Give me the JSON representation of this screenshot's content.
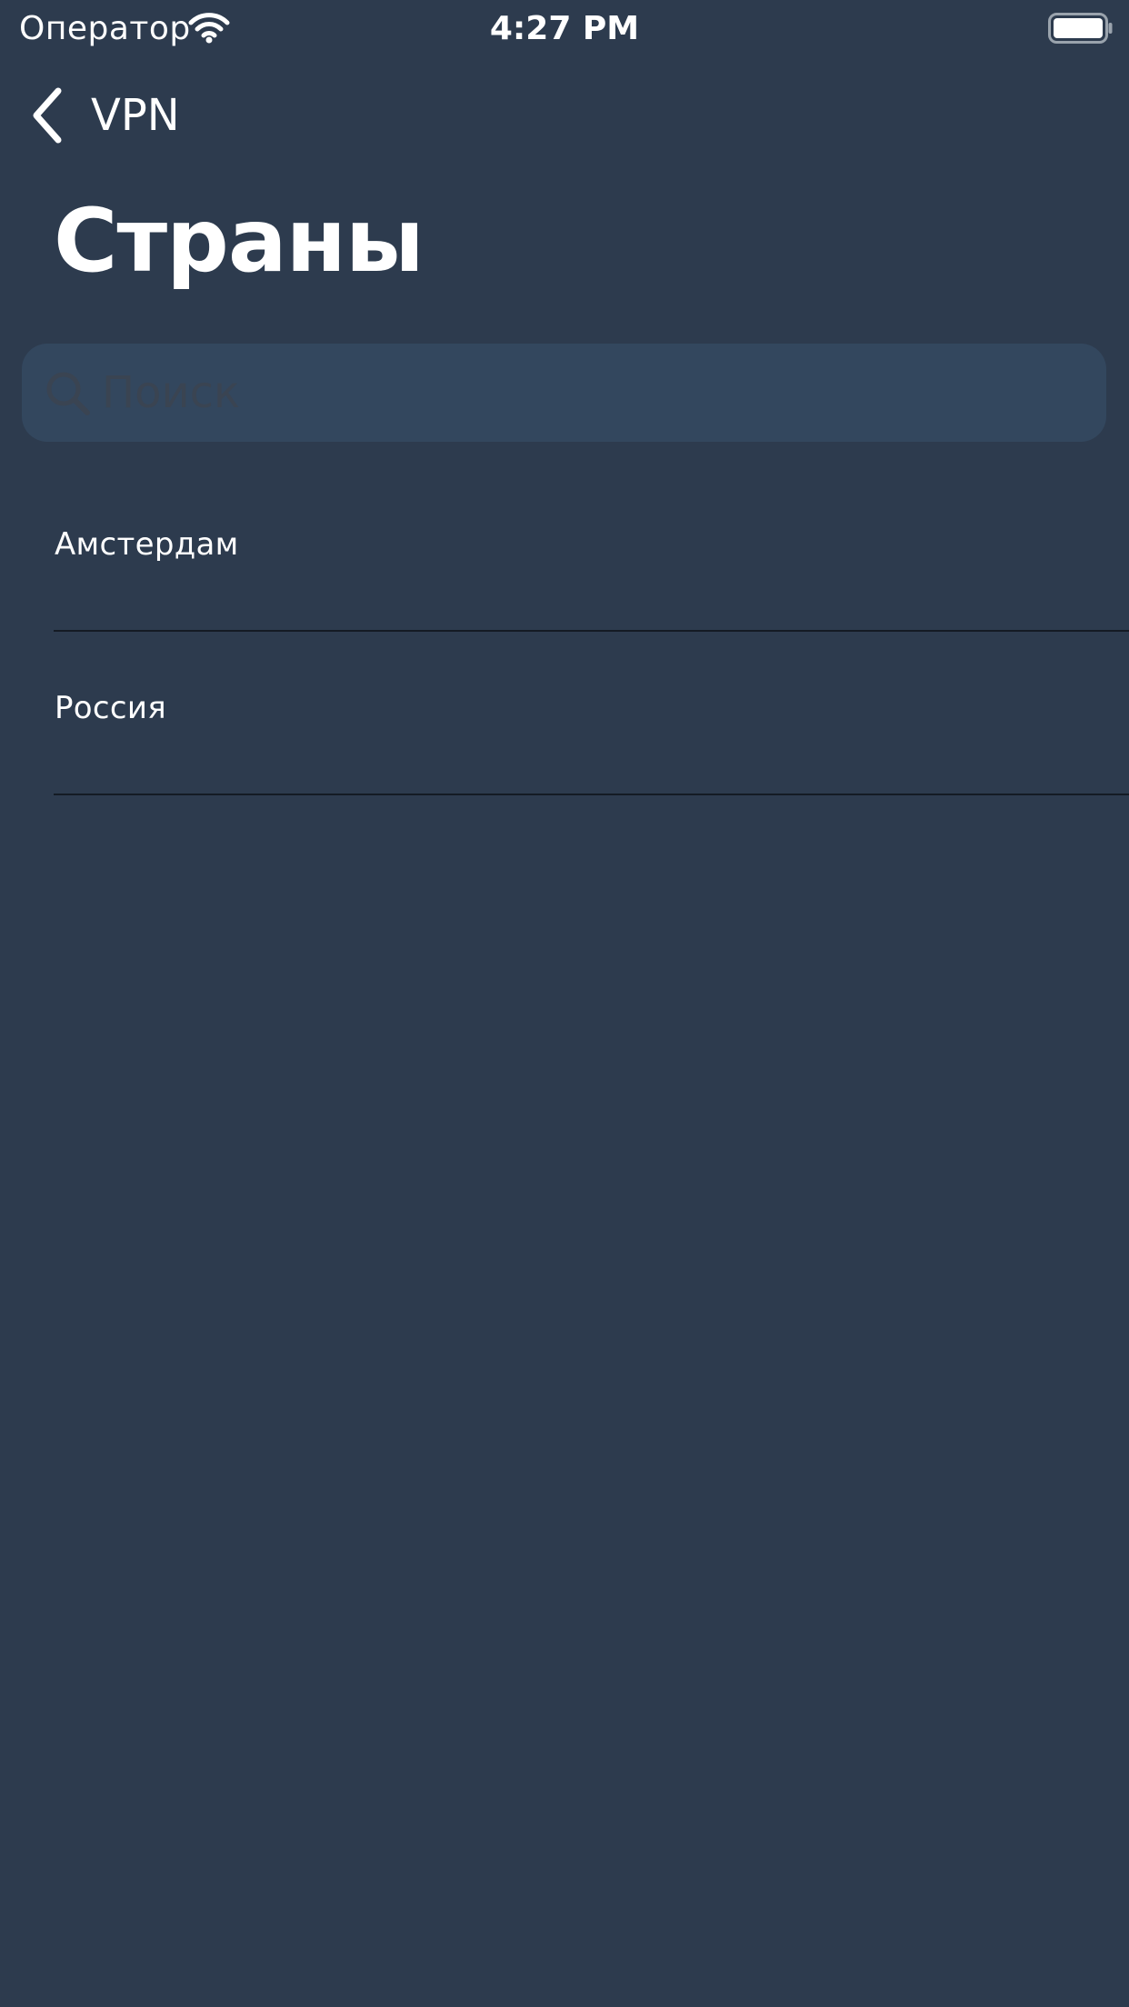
{
  "status_bar": {
    "carrier": "Оператор",
    "time": "4:27 PM",
    "icons": [
      "wifi-icon",
      "battery-icon"
    ]
  },
  "nav": {
    "back_label": "VPN",
    "back_icon": "chevron-left-icon"
  },
  "page": {
    "title": "Страны"
  },
  "search": {
    "placeholder": "Поиск",
    "value": "",
    "icon": "search-icon"
  },
  "list": {
    "items": [
      {
        "label": "Амстердам"
      },
      {
        "label": "Россия"
      }
    ]
  },
  "colors": {
    "background": "#2d3b4e",
    "search_field": "#33475e",
    "placeholder": "#3a4452",
    "separator": "#141b24",
    "text": "#ffffff"
  }
}
